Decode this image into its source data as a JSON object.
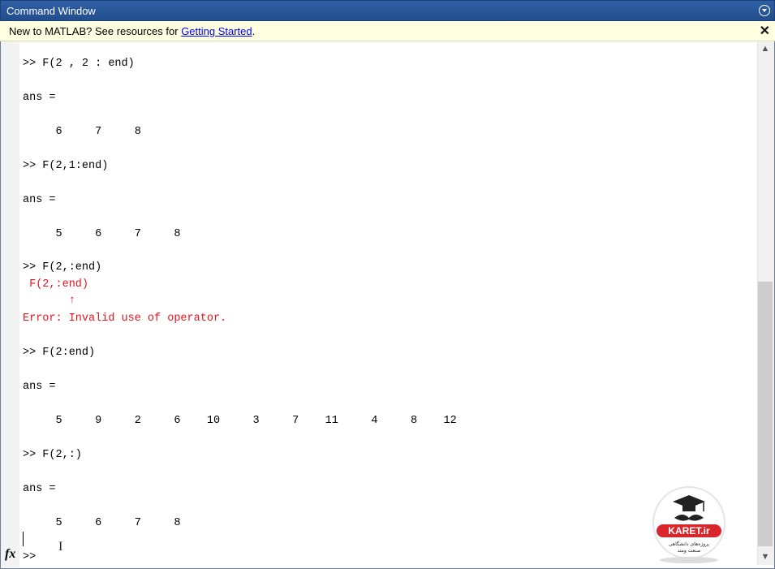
{
  "window": {
    "title": "Command Window"
  },
  "notice": {
    "prefix": "New to MATLAB? See resources for ",
    "link": "Getting Started",
    "suffix": ".",
    "close": "✕"
  },
  "console": [
    ">> F(2 , 2 : end)",
    "ans =",
    "     6     7     8",
    ">> F(2,1:end)",
    "ans =",
    "     5     6     7     8",
    ">> F(2,:end)",
    " F(2,:end)",
    "       ↑",
    "Error: Invalid use of operator.",
    ">> F(2:end)",
    "ans =",
    "     5     9     2     6    10     3     7    11     4     8    12",
    ">> F(2,:)",
    "ans =",
    "     5     6     7     8"
  ],
  "prompt": {
    "fx": "fx",
    "symbol": ">>"
  },
  "logo": {
    "name": "KARET.ir",
    "tagline1": "پروژه‌های دانشگاهی",
    "tagline2": "صنعت ومتد"
  },
  "colors": {
    "titlebar": "#2f5fa5",
    "notice_bg": "#ffffe1",
    "error": "#e8121b",
    "link": "#0000ee",
    "logo_red": "#d8262b"
  }
}
